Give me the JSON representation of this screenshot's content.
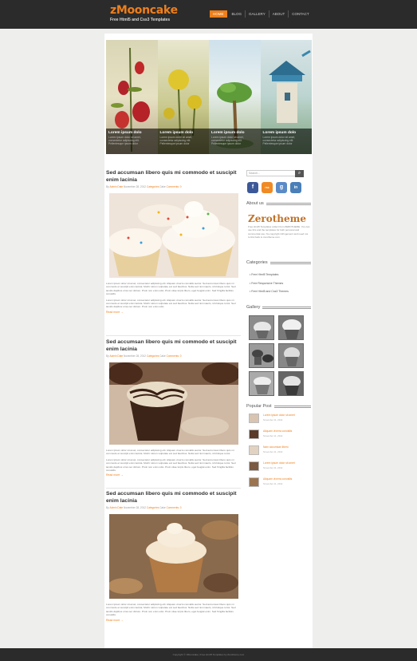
{
  "header": {
    "logo_name": "zMooncake",
    "logo_tagline": "Free Html5 and Css3 Templates",
    "nav": [
      "HOME",
      "BLOG",
      "GALLERY",
      "ABOUT",
      "CONTACT"
    ]
  },
  "slider": {
    "slides": [
      {
        "title": "Lorem ipsum dolo",
        "text": "Lorem ipsum dolor sit amet, consectetur adipiscing elit. Pellentesque ipsum dolor"
      },
      {
        "title": "Lorem ipsum dolo",
        "text": "Lorem ipsum dolor sit amet, consectetur adipiscing elit. Pellentesque ipsum dolor"
      },
      {
        "title": "Lorem ipsum dolo",
        "text": "Lorem ipsum dolor sit amet, consectetur adipiscing elit. Pellentesque ipsum dolor"
      },
      {
        "title": "Lorem ipsum dolo",
        "text": "Lorem ipsum dolor sit amet, consectetur adipiscing elit. Pellentesque ipsum dolor"
      }
    ]
  },
  "posts": [
    {
      "title": "Sed accumsan libero quis mi commodo et suscipit enim lacinia",
      "by": "By",
      "author": "Admin",
      "date_label": "Date",
      "date": "November 28, 2012",
      "cat_label": "Categories",
      "cat": "Cake",
      "comments": "Comments: 0",
      "p1": "Lorem ipsum dolor sit amet, consectetur adipiscing elit. Aliquam viverra convallis auctor. Sed accumsan libero quis mi commodo et suscipit enim lacinia. Morbi rutrum vulputate est sed faucibus. Nulla sed nisl mauris, id tristique tortor. Sed iaculis dapibus urna nec dictum. Proin non enim odio. Proin vitae turpis libero, eget feugiat enim. Sed fringilla facilisis convallis.",
      "p2": "Lorem ipsum dolor sit amet, consectetur adipiscing elit. Aliquam viverra convallis auctor. Sed accumsan libero quis mi commodo et suscipit enim lacinia. Morbi rutrum vulputate est sed faucibus. Nulla sed nisl mauris, id tristique tortor. Sed iaculis dapibus urna nec dictum. Proin non enim odio.",
      "more": "Read more →"
    },
    {
      "title": "Sed accumsan libero quis mi commodo et suscipit enim lacinia",
      "by": "By",
      "author": "Admin",
      "date_label": "Date",
      "date": "November 28, 2012",
      "cat_label": "Categories",
      "cat": "Cake",
      "comments": "Comments: 0",
      "p1": "Lorem ipsum dolor sit amet, consectetur adipiscing elit. Aliquam viverra convallis auctor. Sed accumsan libero quis mi commodo et suscipit enim lacinia. Morbi rutrum vulputate est sed faucibus. Nulla sed nisl mauris, id tristique tortor.",
      "p2": "Lorem ipsum dolor sit amet, consectetur adipiscing elit. Aliquam viverra convallis auctor. Sed accumsan libero quis mi commodo et suscipit enim lacinia. Morbi rutrum vulputate est sed faucibus. Nulla sed nisl mauris, id tristique tortor. Sed iaculis dapibus urna nec dictum. Proin non enim odio. Proin vitae turpis libero, eget feugiat enim. Sed fringilla facilisis convallis.",
      "more": "Read more →"
    },
    {
      "title": "Sed accumsan libero quis mi commodo et suscipit enim lacinia",
      "by": "By",
      "author": "Admin",
      "date_label": "Date",
      "date": "November 28, 2012",
      "cat_label": "Categories",
      "cat": "Cake",
      "comments": "Comments: 0",
      "p1": "Lorem ipsum dolor sit amet, consectetur adipiscing elit. Aliquam viverra convallis auctor. Sed accumsan libero quis mi commodo et suscipit enim lacinia. Morbi rutrum vulputate est sed faucibus. Nulla sed nisl mauris, id tristique tortor. Sed iaculis dapibus urna nec dictum. Proin non enim odio. Proin vitae turpis libero, eget feugiat enim. Sed fringilla facilisis convallis.",
      "p2": "",
      "more": "Read more →"
    }
  ],
  "sidebar": {
    "search_placeholder": "Search...",
    "social": [
      "f",
      "rss",
      "g",
      "in"
    ],
    "about_title": "About us",
    "about_logo": "Zerotheme",
    "about_text": "Free Html5 Templates collect from ZEROTHEME. You can use this and the templates for both personal and commercial use. No copyright infringement and need not to link back to zerotheme.com.",
    "categories_title": "Categories",
    "categories": [
      "Free Html5 Templates",
      "Free Responsive Themes",
      "Free Html5 and Css3 Themes"
    ],
    "gallery_title": "Gallery",
    "popular_title": "Popular Post",
    "popular": [
      {
        "title": "Lorem ipsum dolor sit amet",
        "date": "November 11, 2012"
      },
      {
        "title": "Aliquam viverra convallis",
        "date": "November 11, 2012"
      },
      {
        "title": "Nam accumsan libero",
        "date": "November 11, 2012"
      },
      {
        "title": "Lorem ipsum dolor sit amet",
        "date": "November 11, 2012"
      },
      {
        "title": "Aliquam viverra convallis",
        "date": "November 11, 2012"
      }
    ]
  },
  "footer": {
    "text": "Copyright © zMooncake | Free Html5 Templates by Zerotheme.com"
  },
  "colors": {
    "accent": "#ee7f1b",
    "header_bg": "#2b2b2b",
    "page_bg": "#eeeeec"
  }
}
